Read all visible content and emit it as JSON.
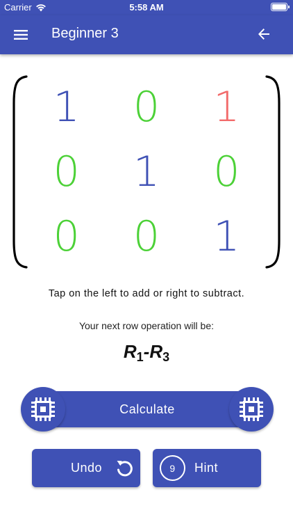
{
  "status_bar": {
    "carrier": "Carrier",
    "time": "5:58 AM"
  },
  "app_bar": {
    "title": "Beginner 3",
    "menu_icon": "hamburger-menu-icon",
    "back_icon": "arrow-left-icon"
  },
  "matrix": {
    "rows": [
      [
        {
          "value": "1",
          "color": "#3f51b5"
        },
        {
          "value": "0",
          "color": "#4cd137"
        },
        {
          "value": "1",
          "color": "#f26b6b"
        }
      ],
      [
        {
          "value": "0",
          "color": "#4cd137"
        },
        {
          "value": "1",
          "color": "#3f51b5"
        },
        {
          "value": "0",
          "color": "#4cd137"
        }
      ],
      [
        {
          "value": "0",
          "color": "#4cd137"
        },
        {
          "value": "0",
          "color": "#4cd137"
        },
        {
          "value": "1",
          "color": "#3f51b5"
        }
      ]
    ]
  },
  "instruction": "Tap on the left to add or right to subtract.",
  "next_operation": {
    "label": "Your next row operation will be:",
    "row_a": "R",
    "row_a_index": "1",
    "operator": "-",
    "row_b": "R",
    "row_b_index": "3"
  },
  "buttons": {
    "calculate": "Calculate",
    "undo": "Undo",
    "hint": "Hint",
    "hint_count": "9"
  },
  "colors": {
    "primary": "#3f51b5",
    "green": "#4cd137",
    "red": "#f26b6b"
  }
}
